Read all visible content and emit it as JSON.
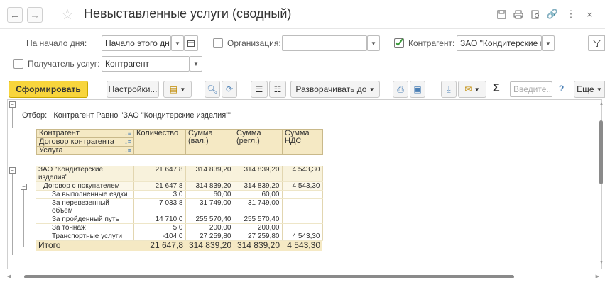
{
  "header": {
    "title": "Невыставленные услуги (сводный)"
  },
  "filters": {
    "start_label": "На начало дня:",
    "start_value": "Начало этого дня",
    "org_label": "Организация:",
    "org_value": "",
    "counterparty_label": "Контрагент:",
    "counterparty_value": "ЗАО \"Кондитерские и",
    "counterparty_checked": true,
    "recipient_label": "Получатель услуг:",
    "recipient_value": "Контрагент"
  },
  "toolbar": {
    "generate": "Сформировать",
    "settings": "Настройки...",
    "expand_to": "Разворачивать до",
    "search_placeholder": "Введите...",
    "help": "?",
    "more": "Еще"
  },
  "report": {
    "filter_label": "Отбор:",
    "filter_text": "Контрагент Равно \"ЗАО \"Кондитерские изделия\"\"",
    "headers": {
      "row1": "Контрагент",
      "row2": "Договор контрагента",
      "row3": "Услуга",
      "qty": "Количество",
      "sum_val_1": "Сумма",
      "sum_val_2": "(вал.)",
      "sum_reg_1": "Сумма",
      "sum_reg_2": "(регл.)",
      "vat_1": "Сумма",
      "vat_2": "НДС"
    },
    "rows": [
      {
        "name": "ЗАО \"Кондитерские",
        "name2": "изделия\"",
        "qty": "21 647,8",
        "val": "314 839,20",
        "reg": "314 839,20",
        "vat": "4 543,30"
      },
      {
        "name": "Договор с покупателем",
        "qty": "21 647,8",
        "val": "314 839,20",
        "reg": "314 839,20",
        "vat": "4 543,30"
      },
      {
        "name": "За выполненные ездки",
        "qty": "3,0",
        "val": "60,00",
        "reg": "60,00",
        "vat": ""
      },
      {
        "name": "За перевезенный",
        "name2": "объем",
        "qty": "7 033,8",
        "val": "31 749,00",
        "reg": "31 749,00",
        "vat": ""
      },
      {
        "name": "За пройденный путь",
        "qty": "14 710,0",
        "val": "255 570,40",
        "reg": "255 570,40",
        "vat": ""
      },
      {
        "name": "За тоннаж",
        "qty": "5,0",
        "val": "200,00",
        "reg": "200,00",
        "vat": ""
      },
      {
        "name": "Транспортные услуги",
        "qty": "-104,0",
        "val": "27 259,80",
        "reg": "27 259,80",
        "vat": "4 543,30"
      }
    ],
    "total": {
      "name": "Итого",
      "qty": "21 647,8",
      "val": "314 839,20",
      "reg": "314 839,20",
      "vat": "4 543,30"
    }
  },
  "colors": {
    "accent_yellow": "#f8d53c",
    "header_bg": "#f5e9c4",
    "check_green": "#3a9a3a"
  }
}
